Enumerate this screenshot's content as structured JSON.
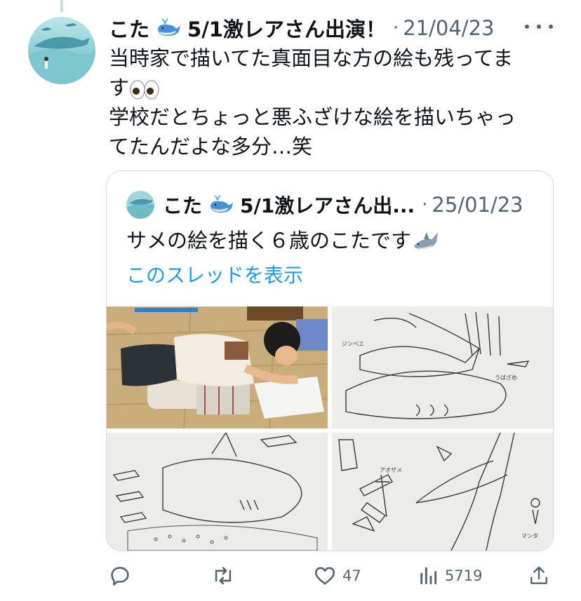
{
  "tweet": {
    "display_name": "こた",
    "name_suffix": "5/1激レアさん出演！",
    "separator": "·",
    "date": "21/04/23",
    "text_line1": "当時家で描いてた真面目な方の絵も残ってま",
    "text_line2": "す",
    "text_line3": "学校だとちょっと悪ふざけな絵を描いちゃっ",
    "text_line4": "てたんだよな多分…笑"
  },
  "quoted": {
    "display_name": "こた",
    "name_suffix": "5/1激レアさん出...",
    "separator": "·",
    "date": "25/01/23",
    "text": "サメの絵を描く６歳のこたです",
    "show_thread": "このスレッドを表示"
  },
  "actions": {
    "likes": "47",
    "views": "5719"
  },
  "colors": {
    "text": "#0f1419",
    "secondary": "#536471",
    "link": "#1d9bf0",
    "border": "#cfd9de"
  },
  "icons": [
    "reply-icon",
    "retweet-icon",
    "like-icon",
    "views-icon",
    "share-icon",
    "more-icon",
    "whale-emoji-icon",
    "eyes-emoji-icon",
    "shark-emoji-icon"
  ]
}
